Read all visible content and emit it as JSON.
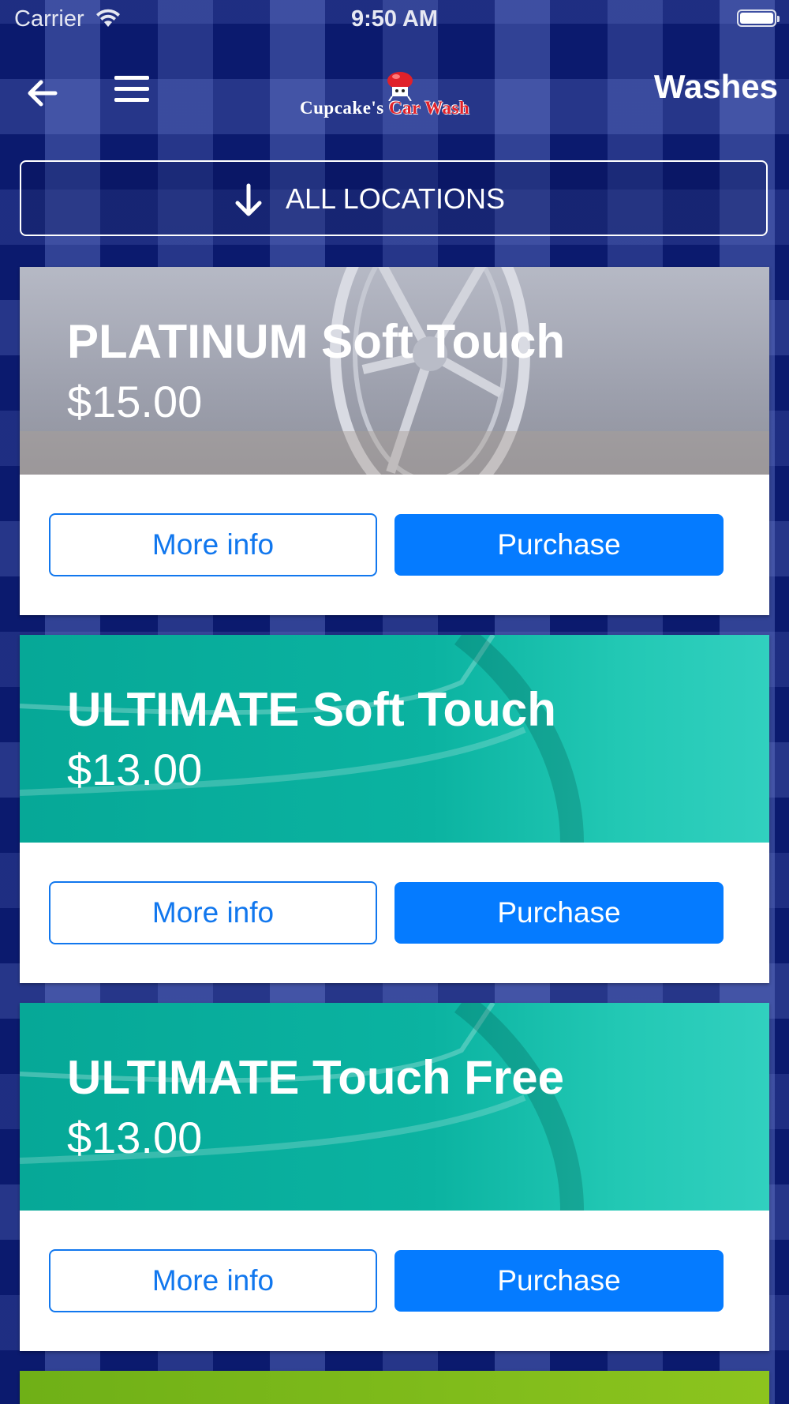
{
  "status_bar": {
    "carrier": "Carrier",
    "time": "9:50 AM"
  },
  "nav": {
    "back_icon": "arrow-left-icon",
    "menu_icon": "hamburger-menu-icon",
    "logo": {
      "part1": "Cupcake's",
      "part2": "Car Wash"
    },
    "title": "Washes"
  },
  "locations": {
    "label": "ALL LOCATIONS",
    "icon": "arrow-down-icon"
  },
  "washes": [
    {
      "name": "PLATINUM Soft Touch",
      "price": "$15.00",
      "more_label": "More info",
      "purchase_label": "Purchase",
      "banner_color": "#a3a6b3"
    },
    {
      "name": "ULTIMATE Soft Touch",
      "price": "$13.00",
      "more_label": "More info",
      "purchase_label": "Purchase",
      "banner_color": "#0bb3a1"
    },
    {
      "name": "ULTIMATE Touch Free",
      "price": "$13.00",
      "more_label": "More info",
      "purchase_label": "Purchase",
      "banner_color": "#0bb3a1"
    }
  ],
  "colors": {
    "background": "#0b1a6e",
    "primary_button": "#057bff",
    "partial_card_banner": "#7cb81a"
  }
}
